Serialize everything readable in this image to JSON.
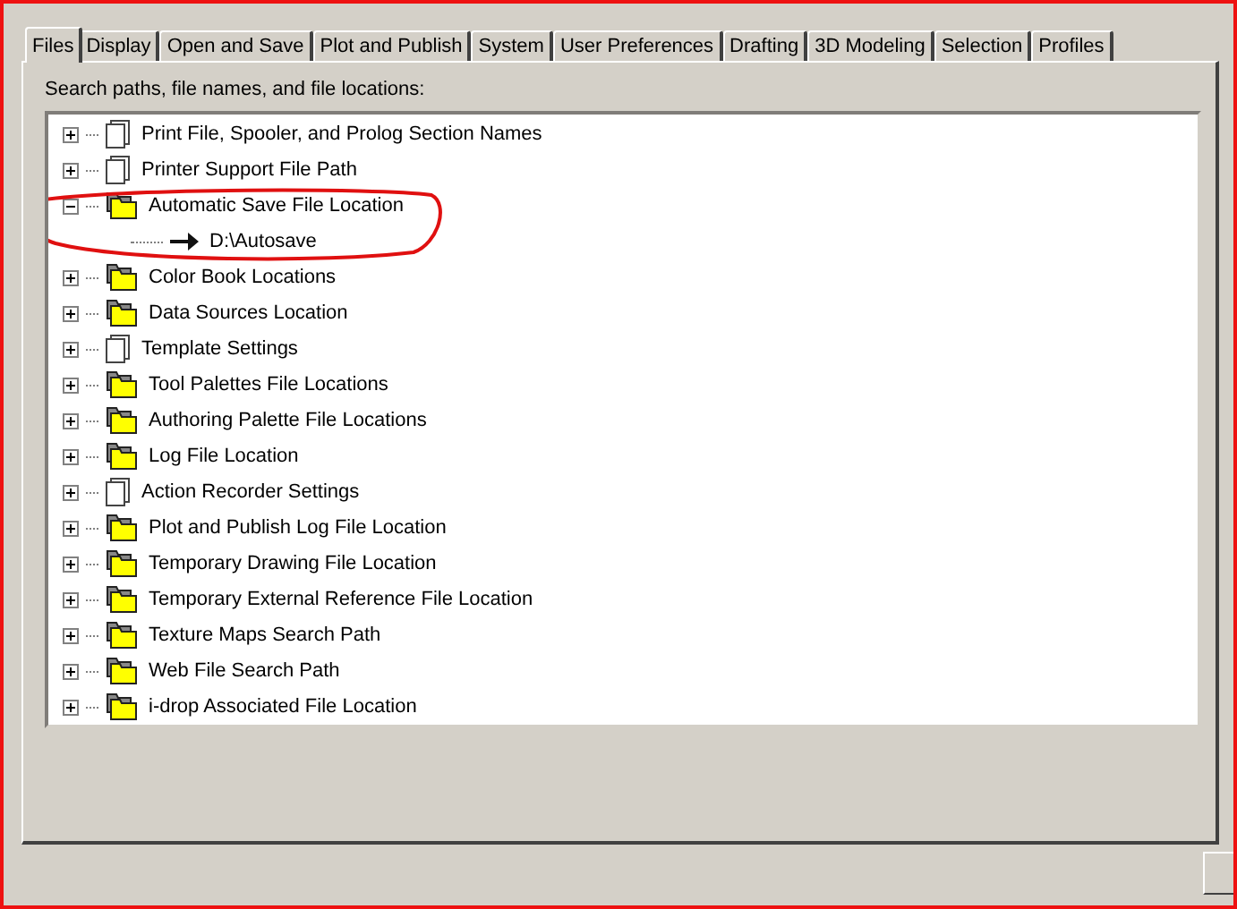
{
  "tabs": [
    {
      "label": "Files",
      "selected": true
    },
    {
      "label": "Display",
      "selected": false
    },
    {
      "label": "Open and Save",
      "selected": false
    },
    {
      "label": "Plot and Publish",
      "selected": false
    },
    {
      "label": "System",
      "selected": false
    },
    {
      "label": "User Preferences",
      "selected": false
    },
    {
      "label": "Drafting",
      "selected": false
    },
    {
      "label": "3D Modeling",
      "selected": false
    },
    {
      "label": "Selection",
      "selected": false
    },
    {
      "label": "Profiles",
      "selected": false
    }
  ],
  "tree": {
    "label": "Search paths, file names, and file locations:",
    "items": [
      {
        "label": "Print File, Spooler, and Prolog Section Names",
        "kind": "document",
        "expanded": false
      },
      {
        "label": "Printer Support File Path",
        "kind": "document",
        "expanded": false
      },
      {
        "label": "Automatic Save File Location",
        "kind": "folder",
        "expanded": true,
        "highlighted": true,
        "children": [
          {
            "label": "D:\\Autosave",
            "kind": "path"
          }
        ]
      },
      {
        "label": "Color Book Locations",
        "kind": "folder",
        "expanded": false
      },
      {
        "label": "Data Sources Location",
        "kind": "folder",
        "expanded": false
      },
      {
        "label": "Template Settings",
        "kind": "document",
        "expanded": false
      },
      {
        "label": "Tool Palettes File Locations",
        "kind": "folder",
        "expanded": false
      },
      {
        "label": "Authoring Palette File Locations",
        "kind": "folder",
        "expanded": false
      },
      {
        "label": "Log File Location",
        "kind": "folder",
        "expanded": false
      },
      {
        "label": "Action Recorder Settings",
        "kind": "document",
        "expanded": false
      },
      {
        "label": "Plot and Publish Log File Location",
        "kind": "folder",
        "expanded": false
      },
      {
        "label": "Temporary Drawing File Location",
        "kind": "folder",
        "expanded": false
      },
      {
        "label": "Temporary External Reference File Location",
        "kind": "folder",
        "expanded": false
      },
      {
        "label": "Texture Maps Search Path",
        "kind": "folder",
        "expanded": false
      },
      {
        "label": "Web File Search Path",
        "kind": "folder",
        "expanded": false
      },
      {
        "label": "i-drop Associated File Location",
        "kind": "folder",
        "expanded": false
      }
    ]
  }
}
